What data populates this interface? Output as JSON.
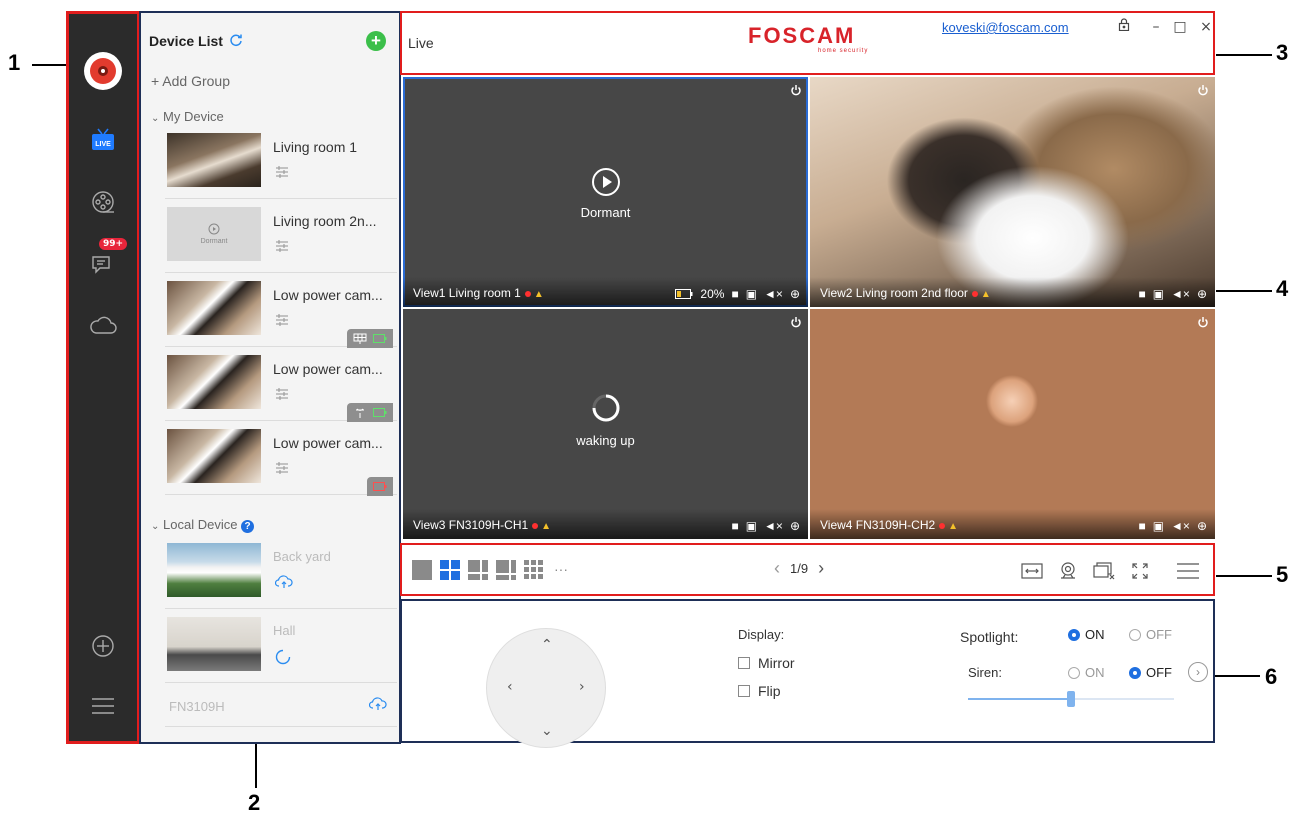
{
  "callouts": [
    "1",
    "2",
    "3",
    "4",
    "5",
    "6"
  ],
  "sidebar": {
    "badge": "99+",
    "icons": [
      "foscam-logo-icon",
      "live-tv-icon",
      "playback-reel-icon",
      "messages-icon",
      "cloud-icon",
      "add-device-icon",
      "menu-icon"
    ],
    "live_tag": "LIVE"
  },
  "device_list": {
    "title": "Device List",
    "add_group": "+ Add Group",
    "my_device": "My Device",
    "local_device": "Local Device",
    "items": [
      {
        "name": "Living room 1"
      },
      {
        "name": "Living room 2n...",
        "thumb_text": "Dormant"
      },
      {
        "name": "Low power cam..."
      },
      {
        "name": "Low power cam..."
      },
      {
        "name": "Low power cam..."
      }
    ],
    "local_items": [
      {
        "name": "Back yard"
      },
      {
        "name": "Hall"
      },
      {
        "name": "FN3109H"
      }
    ]
  },
  "header": {
    "title": "Live",
    "brand": "FOSCAM",
    "brand_sub": "home security",
    "account": "koveski@foscam.com"
  },
  "views": [
    {
      "label": "View1 Living room 1",
      "status": "Dormant",
      "battery": "20%"
    },
    {
      "label": "View2 Living room 2nd floor"
    },
    {
      "label": "View3 FN3109H-CH1",
      "status": "waking up"
    },
    {
      "label": "View4 FN3109H-CH2"
    }
  ],
  "toolbar": {
    "more": "···",
    "page": "1/9",
    "prev": "‹",
    "next": "›"
  },
  "controls": {
    "display_label": "Display:",
    "mirror": "Mirror",
    "flip": "Flip",
    "spotlight_label": "Spotlight:",
    "siren_label": "Siren:",
    "on": "ON",
    "off": "OFF",
    "spotlight_on": true,
    "siren_on": false,
    "slider_level": 0.5
  },
  "colors": {
    "accent": "#1f6fe0",
    "brand": "#d8232a",
    "callout_red": "#e11d1d",
    "callout_navy": "#1e2f57",
    "sidebar_bg": "#2b2b2b",
    "add_green": "#3bbf4a"
  }
}
